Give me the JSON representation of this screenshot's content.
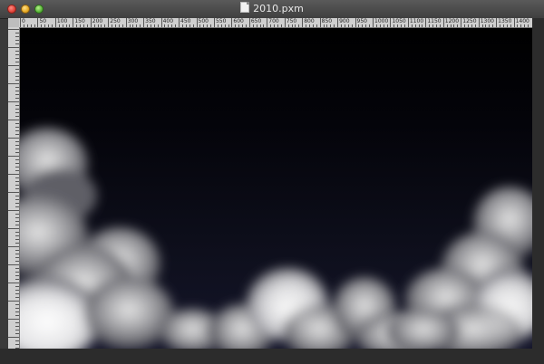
{
  "window": {
    "title": "2010.pxm"
  },
  "ruler": {
    "horizontal_labels": [
      "0",
      "50",
      "100",
      "150",
      "200",
      "250",
      "300",
      "350",
      "400",
      "450",
      "500",
      "550",
      "600",
      "650",
      "700",
      "750",
      "800",
      "850",
      "900",
      "950",
      "1000",
      "1050",
      "1100",
      "1150",
      "1200",
      "1250",
      "1300",
      "1350",
      "1400"
    ]
  },
  "colors": {
    "sky_top": "#000000",
    "sky_bottom": "#14152a",
    "cloud": "#d8d8d8"
  }
}
